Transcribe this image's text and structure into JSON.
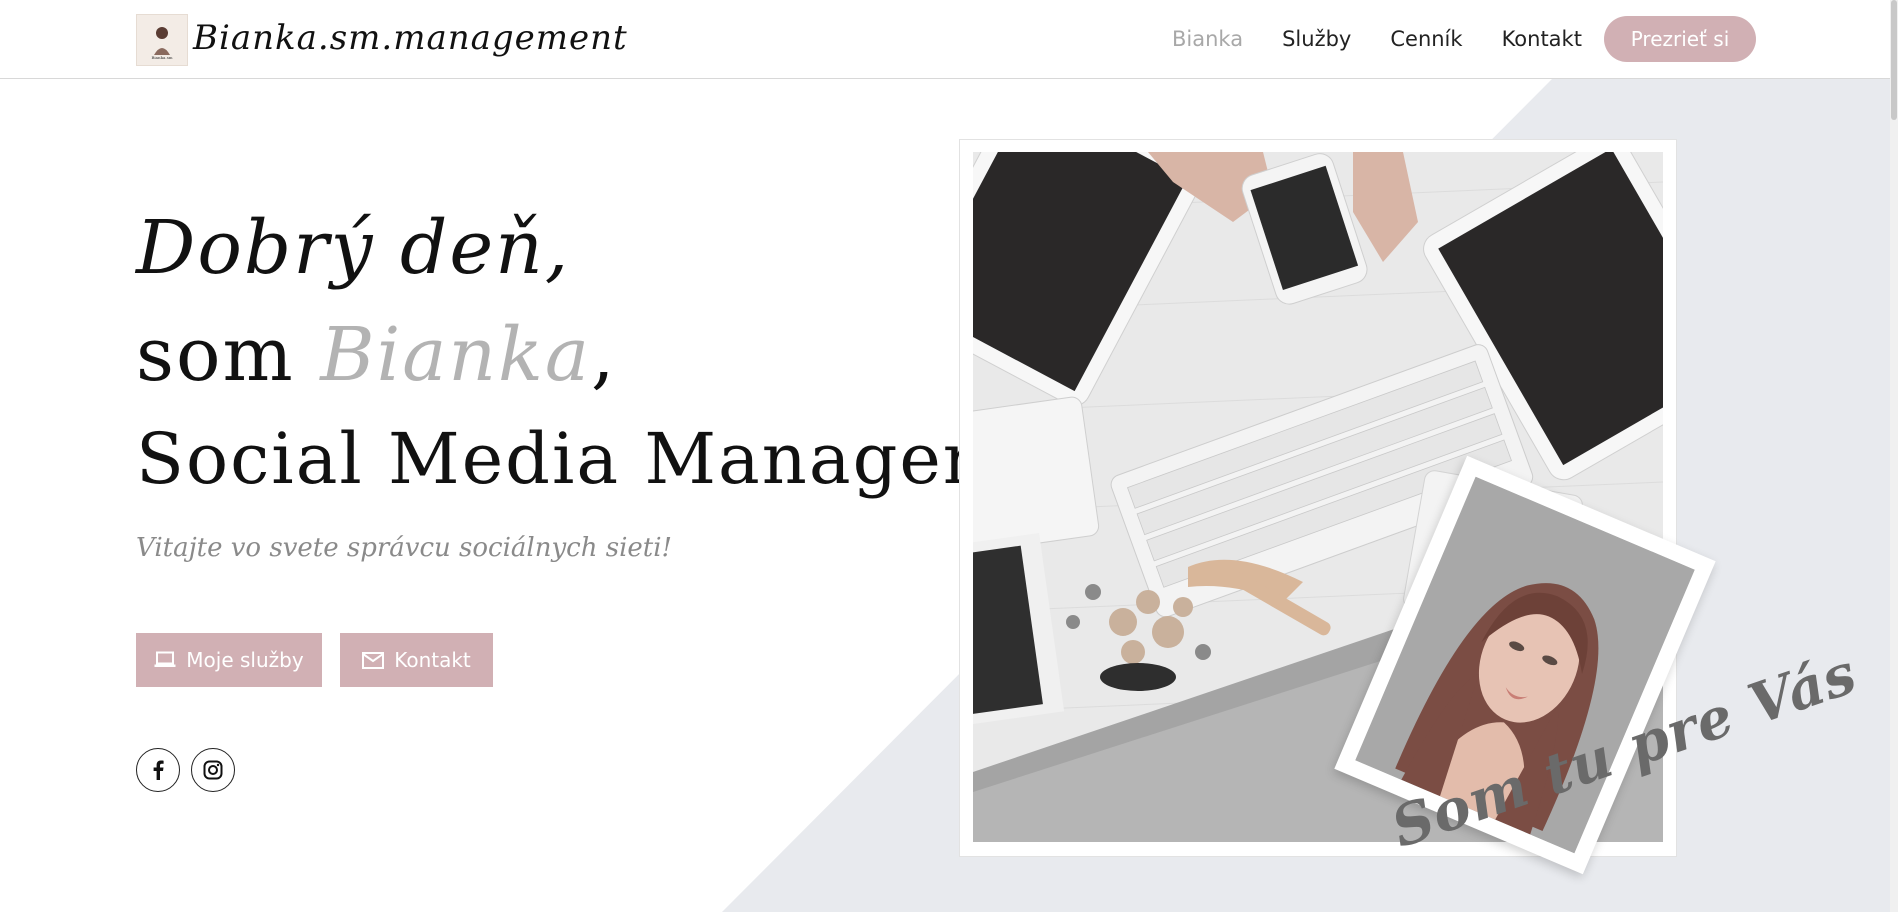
{
  "header": {
    "logo_text": "Bianka.sm.management",
    "nav": [
      "Bianka",
      "Služby",
      "Cenník",
      "Kontakt"
    ],
    "cta": "Prezrieť si"
  },
  "hero": {
    "line1": "Dobrý deň,",
    "line2_prefix": "som ",
    "line2_name": "Bianka",
    "line2_suffix": ",",
    "line3": "Social Media Manager",
    "subtitle": "Vitajte vo svete správcu sociálnych sieti!",
    "buttons": {
      "services": "Moje služby",
      "contact": "Kontakt"
    }
  },
  "images": {
    "script_text": "Som tu pre Vás"
  },
  "icons": {
    "services_button_icon": "laptop-icon",
    "contact_button_icon": "mail-icon",
    "facebook": "facebook-icon",
    "instagram": "instagram-icon"
  },
  "colors": {
    "accent": "#d1b0b4",
    "muted_text": "#b3b3b3",
    "diagonal_bg": "#e8eaee"
  }
}
